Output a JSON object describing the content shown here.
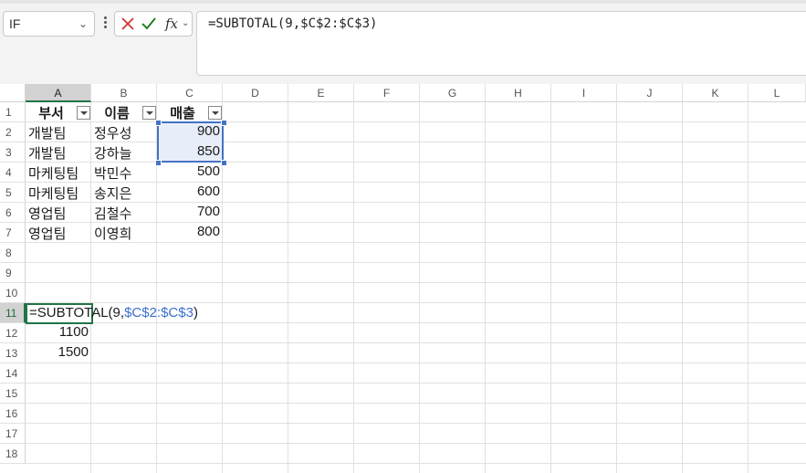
{
  "namebox": {
    "value": "IF",
    "caret": "⌄"
  },
  "formula_bar": {
    "cancel_icon": "x-icon",
    "enter_icon": "check-icon",
    "fx_label": "fx",
    "fx_caret": "⌄",
    "formula": "=SUBTOTAL(9,$C$2:$C$3)"
  },
  "columns": [
    "A",
    "B",
    "C",
    "D",
    "E",
    "F",
    "G",
    "H",
    "I",
    "J",
    "K",
    "L"
  ],
  "rows": [
    "1",
    "2",
    "3",
    "4",
    "5",
    "6",
    "7",
    "8",
    "9",
    "10",
    "11",
    "12",
    "13",
    "14",
    "15",
    "16",
    "17",
    "18"
  ],
  "table": {
    "headers": [
      "부서",
      "이름",
      "매출"
    ],
    "records": [
      {
        "dept": "개발팀",
        "name": "정우성",
        "sales": "900"
      },
      {
        "dept": "개발팀",
        "name": "강하늘",
        "sales": "850"
      },
      {
        "dept": "마케팅팀",
        "name": "박민수",
        "sales": "500"
      },
      {
        "dept": "마케팅팀",
        "name": "송지은",
        "sales": "600"
      },
      {
        "dept": "영업팀",
        "name": "김철수",
        "sales": "700"
      },
      {
        "dept": "영업팀",
        "name": "이영희",
        "sales": "800"
      }
    ]
  },
  "editing_cell": {
    "address": "A11",
    "prefix": "=SUBTOTAL(9,",
    "reference": "$C$2:$C$3",
    "suffix": ")"
  },
  "results": {
    "a12": "1100",
    "a13": "1500"
  },
  "colors": {
    "accent": "#217346",
    "range_highlight": "#4472c4",
    "reference_text": "#3a6fd0"
  }
}
